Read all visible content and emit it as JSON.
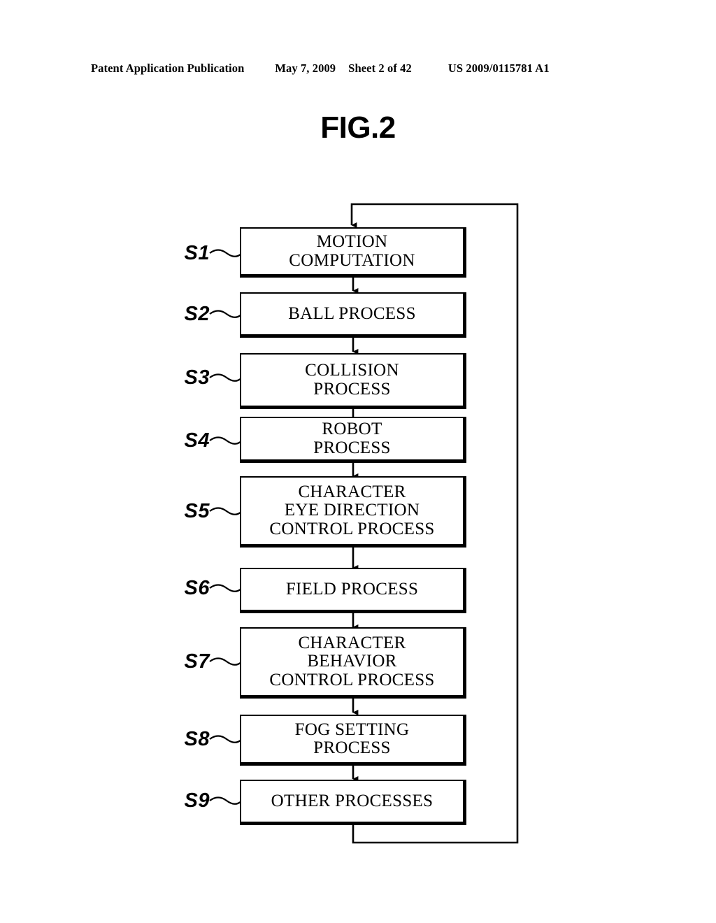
{
  "header": {
    "publication": "Patent Application Publication",
    "date": "May 7, 2009",
    "sheet": "Sheet 2 of 42",
    "patent_number": "US 2009/0115781 A1"
  },
  "figure": {
    "title": "FIG.2"
  },
  "flowchart": {
    "steps": [
      {
        "id": "S1",
        "label": "S1",
        "text": "MOTION\nCOMPUTATION",
        "lines": 2
      },
      {
        "id": "S2",
        "label": "S2",
        "text": "BALL PROCESS",
        "lines": 1
      },
      {
        "id": "S3",
        "label": "S3",
        "text": "COLLISION\nPROCESS",
        "lines": 2
      },
      {
        "id": "S4",
        "label": "S4",
        "text": "ROBOT\nPROCESS",
        "lines": 2
      },
      {
        "id": "S5",
        "label": "S5",
        "text": "CHARACTER\nEYE DIRECTION\nCONTROL PROCESS",
        "lines": 3
      },
      {
        "id": "S6",
        "label": "S6",
        "text": "FIELD PROCESS",
        "lines": 1
      },
      {
        "id": "S7",
        "label": "S7",
        "text": "CHARACTER\nBEHAVIOR\nCONTROL PROCESS",
        "lines": 3
      },
      {
        "id": "S8",
        "label": "S8",
        "text": "FOG SETTING\nPROCESS",
        "lines": 2
      },
      {
        "id": "S9",
        "label": "S9",
        "text": "OTHER PROCESSES",
        "lines": 1
      }
    ],
    "loop": {
      "description": "return-loop-from-last-step-to-first-step"
    },
    "colors": {
      "ink": "#000000",
      "paper": "#ffffff"
    }
  }
}
